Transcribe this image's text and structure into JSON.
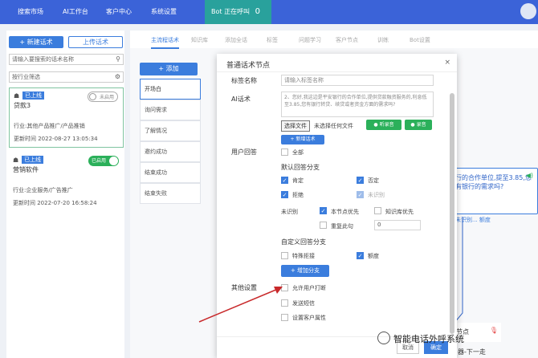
{
  "topbar": {
    "nav": [
      "搜索市场",
      "AI工作台",
      "客户中心",
      "系统设置"
    ],
    "bot_label": "Bot 正在呼叫",
    "bot_count": "0"
  },
  "left": {
    "new_btn": "+ 新建话术",
    "upload_btn": "上传话术",
    "search_placeholder": "请输入要搜索的话术名称",
    "filter_placeholder": "按行业筛选",
    "cards": [
      {
        "badge": "已上线",
        "name": "贷款3",
        "toggle": "未启用",
        "industry": "行业:其他产品推广/产品推销",
        "updated": "更新时间 2022-08-27 13:05:34"
      },
      {
        "badge": "已上线",
        "name": "营销软件",
        "toggle": "已启用",
        "industry": "行业:企业服务/广告推广",
        "updated": "更新时间 2022-07-20 16:58:24"
      }
    ]
  },
  "canvas": {
    "tabs": [
      "主流程话术",
      "知识库",
      "添加全话",
      "标签",
      "问题学习",
      "客户节点",
      "训练",
      "Bot设置"
    ],
    "add_btn": "+ 添加",
    "nodes": [
      "开场白",
      "询问需求",
      "了解情况",
      "邀约成功",
      "结束成功",
      "结束失败"
    ],
    "graph_node_text": "行的合作单位,提至3.85,您有银行的需求吗?",
    "graph_node_foot": "未识别...   额度",
    "node2_text": "节点",
    "node2_tail": "器-下一走"
  },
  "modal": {
    "title": "普通话术节点",
    "close": "×",
    "tag_label": "标签名称",
    "tag_placeholder": "请输入标签名称",
    "ai_label": "AI话术",
    "ai_text": "2、您好,我这边是平安银行的合作单位,提供贷款融资服务的,利息低至3.85,您有银行转贷、续贷或者资金方面的需求吗?",
    "file_btn": "选择文件",
    "file_none": "未选择任何文件",
    "listen_btn": "● 听录音",
    "record_btn": "● 录音",
    "new_script_btn": "+ 新增话术",
    "user_answer_label": "用户回答",
    "all_label": "全部",
    "default_branch": "默认回答分支",
    "opt_ken": "肯定",
    "opt_neg": "否定",
    "opt_refuse": "拒绝",
    "opt_unknown": "未识别",
    "unrec_label": "未识别",
    "node_priority": "本节点优先",
    "kb_priority": "知识库优先",
    "repeat_label": "重复此句",
    "repeat_value": "0",
    "custom_branch": "自定义回答分支",
    "special_refuse": "特殊拒接",
    "quota": "额度",
    "add_branch_btn": "+ 增加分支",
    "other_label": "其他设置",
    "allow_interrupt": "允许用户打断",
    "send_sms": "发送短信",
    "set_attr": "设置客户属性",
    "cancel": "取消",
    "ok": "确定"
  },
  "watermark": "智能电话外呼系统"
}
